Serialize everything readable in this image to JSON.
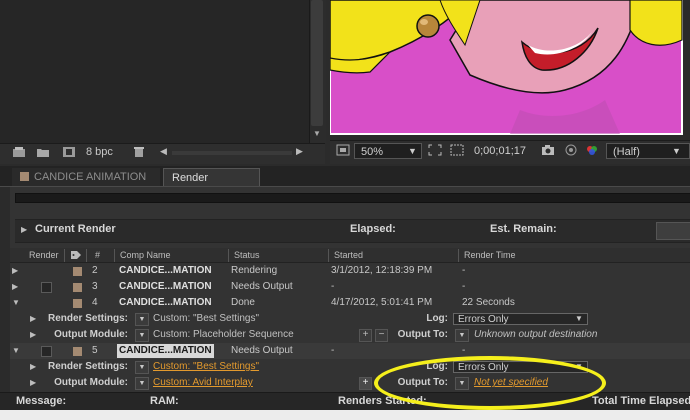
{
  "project": {
    "bit_depth": "8 bpc"
  },
  "viewer": {
    "zoom": "50%",
    "timecode": "0;00;01;17",
    "resolution": "(Half)"
  },
  "tabs": [
    {
      "label": "CANDICE ANIMATION",
      "active": false
    },
    {
      "label": "Render Queue",
      "active": true,
      "close": "×"
    }
  ],
  "current_render": {
    "label": "Current Render",
    "elapsed_label": "Elapsed:",
    "est_remain_label": "Est. Remain:"
  },
  "columns": {
    "render": "Render",
    "num": "#",
    "comp_name": "Comp Name",
    "status": "Status",
    "started": "Started",
    "render_time": "Render Time"
  },
  "rows": [
    {
      "num": "2",
      "comp": "CANDICE...MATION",
      "status": "Rendering",
      "started": "3/1/2012, 12:18:39 PM",
      "render_time": "-"
    },
    {
      "num": "3",
      "comp": "CANDICE...MATION",
      "status": "Needs Output",
      "started": "-",
      "render_time": "-"
    },
    {
      "num": "4",
      "comp": "CANDICE...MATION",
      "status": "Done",
      "started": "4/17/2012, 5:01:41 PM",
      "render_time": "22 Seconds"
    },
    {
      "num": "5",
      "comp": "CANDICE...MATION",
      "status": "Needs Output",
      "started": "-",
      "render_time": "-"
    }
  ],
  "item4": {
    "render_settings_label": "Render Settings:",
    "render_settings_value": "Custom: \"Best Settings\"",
    "output_module_label": "Output Module:",
    "output_module_value": "Custom: Placeholder Sequence",
    "log_label": "Log:",
    "log_value": "Errors Only",
    "output_to_label": "Output To:",
    "output_to_value": "Unknown output destination"
  },
  "item5": {
    "render_settings_label": "Render Settings:",
    "render_settings_value": "Custom: \"Best Settings\"",
    "output_module_label": "Output Module:",
    "output_module_value": "Custom: Avid Interplay",
    "log_label": "Log:",
    "log_value": "Errors Only",
    "output_to_label": "Output To:",
    "output_to_value": "Not yet specified"
  },
  "status_bar": {
    "message": "Message:",
    "ram": "RAM:",
    "renders_started": "Renders Started:",
    "total_time": "Total Time Elapsed:"
  },
  "colors": {
    "label_swatch": "#a48a72",
    "orange_link": "#e39a2e",
    "highlight": "#f5ef1c",
    "cartoon_magenta": "#d84fc8",
    "cartoon_yellow": "#f2e21a"
  },
  "icons": [
    "new-folder-icon",
    "folder-icon",
    "film-icon",
    "trash-icon",
    "camera-icon",
    "grid-icon",
    "color-icon"
  ]
}
